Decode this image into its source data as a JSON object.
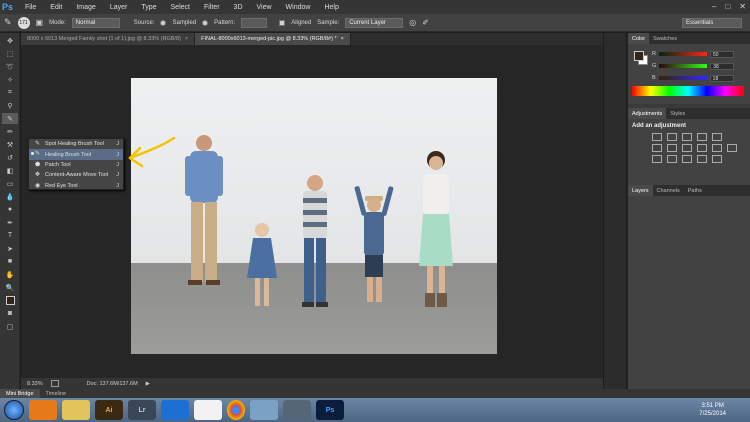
{
  "menubar": {
    "logo": "Ps",
    "items": [
      "File",
      "Edit",
      "Image",
      "Layer",
      "Type",
      "Select",
      "Filter",
      "3D",
      "View",
      "Window",
      "Help"
    ]
  },
  "options": {
    "brush_size": "171",
    "mode_label": "Mode:",
    "mode_value": "Normal",
    "source_label": "Source:",
    "sampled_label": "Sampled",
    "pattern_label": "Pattern:",
    "aligned_label": "Aligned",
    "sample_label": "Sample:",
    "sample_value": "Current Layer",
    "workspace": "Essentials"
  },
  "tabs": [
    {
      "label": "8000 x 6013 Merged Family shot (1 of 1).jpg @ 8.33% (RGB/8)",
      "active": false
    },
    {
      "label": "FINAL-8000x6013-merged-pic.jpg @ 8.33% (RGB/8#) *",
      "active": true
    }
  ],
  "status": {
    "zoom": "8.33%",
    "doc": "Doc: 137.6M/137.6M"
  },
  "flyout": {
    "items": [
      {
        "label": "Spot Healing Brush Tool",
        "key": "J",
        "selected": false
      },
      {
        "label": "Healing Brush Tool",
        "key": "J",
        "selected": true
      },
      {
        "label": "Patch Tool",
        "key": "J",
        "selected": false
      },
      {
        "label": "Content-Aware Move Tool",
        "key": "J",
        "selected": false
      },
      {
        "label": "Red Eye Tool",
        "key": "J",
        "selected": false
      }
    ]
  },
  "color_panel": {
    "tabs": [
      "Color",
      "Swatches"
    ],
    "r_label": "R",
    "r_value": "50",
    "g_label": "G",
    "g_value": "38",
    "b_label": "B",
    "b_value": "18"
  },
  "adjustments": {
    "tabs": [
      "Adjustments",
      "Styles"
    ],
    "title": "Add an adjustment"
  },
  "layers": {
    "tabs": [
      "Layers",
      "Channels",
      "Paths"
    ]
  },
  "bottom_tabs": [
    "Mini Bridge",
    "Timeline"
  ],
  "taskbar": {
    "apps": [
      "Ai",
      "Lr",
      "Ps"
    ],
    "time": "3:51 PM",
    "date": "7/25/2014"
  },
  "colors": {
    "accent_arrow": "#f5c400",
    "foreground": "#32261a",
    "selection": "#5a6c88"
  }
}
